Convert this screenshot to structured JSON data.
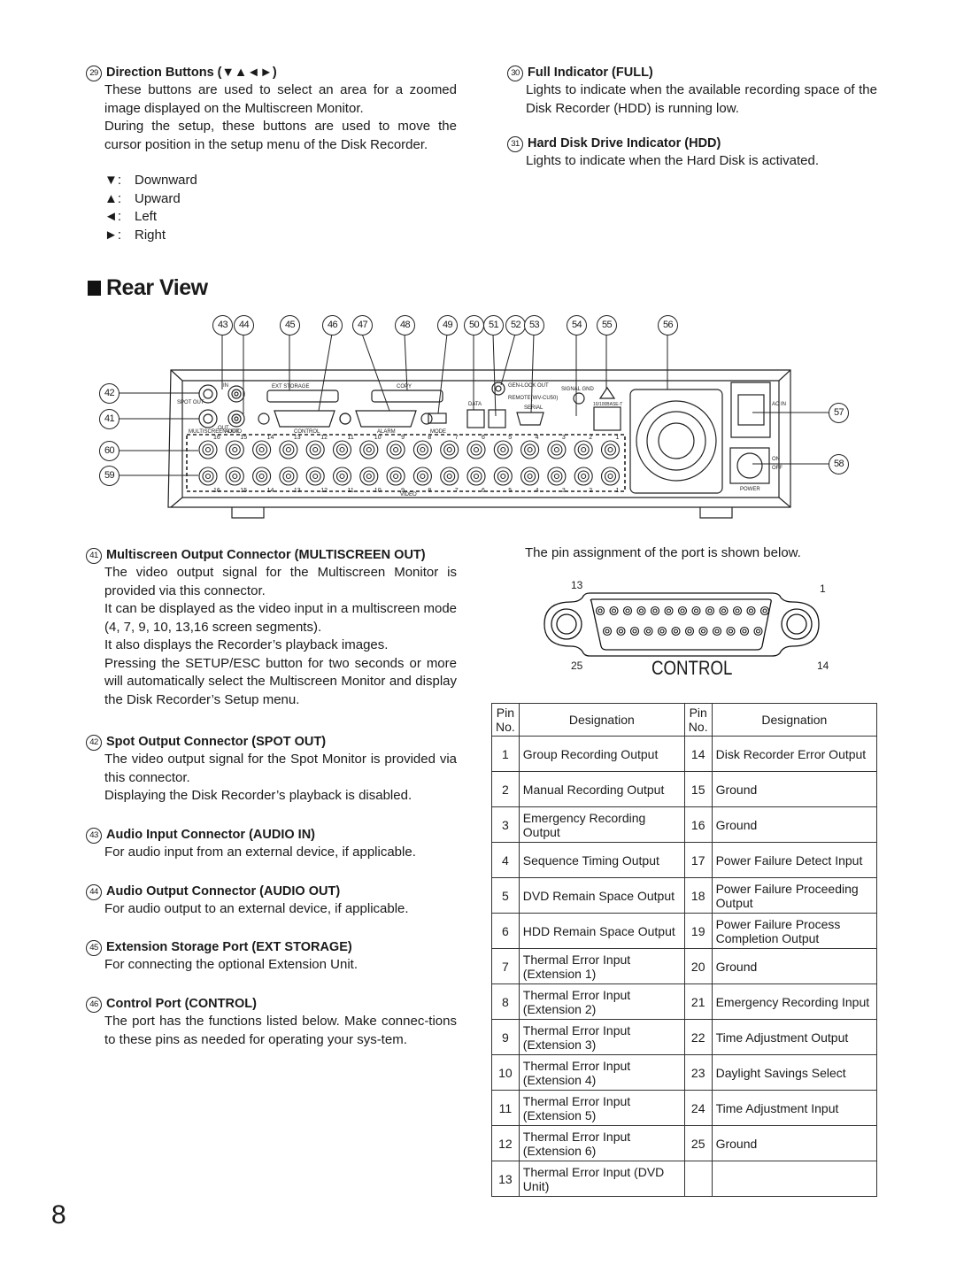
{
  "page_number": "8",
  "top_left": {
    "number": "29",
    "title": "Direction Buttons (▼▲◄►)",
    "paragraphs": [
      "These buttons are used to select an area for a zoomed image displayed on the Multiscreen Monitor.",
      "During the setup, these buttons are used to move the cursor position in the setup menu of the Disk Recorder."
    ],
    "directions": [
      {
        "symbol": "▼:",
        "label": "Downward"
      },
      {
        "symbol": "▲:",
        "label": "Upward"
      },
      {
        "symbol": "◄:",
        "label": "Left"
      },
      {
        "symbol": "►:",
        "label": "Right"
      }
    ]
  },
  "top_right": [
    {
      "number": "30",
      "title": "Full Indicator (FULL)",
      "text": "Lights to indicate when the available recording space of the Disk Recorder (HDD) is running low."
    },
    {
      "number": "31",
      "title": "Hard Disk Drive Indicator (HDD)",
      "text": "Lights to indicate when the Hard Disk is activated."
    }
  ],
  "rear_view": {
    "heading": "Rear View",
    "top_callouts": [
      "43",
      "44",
      "45",
      "46",
      "47",
      "48",
      "49",
      "50",
      "51",
      "52",
      "53",
      "54",
      "55",
      "56"
    ],
    "left_callouts": [
      "42",
      "41",
      "60",
      "59"
    ],
    "right_callouts": [
      "57",
      "58"
    ],
    "panel_labels": {
      "spot_out": "SPOT OUT",
      "in": "IN",
      "out": "OUT",
      "multiscreen_out": "MULTISCREEN OUT",
      "audio": "AUDIO",
      "ext_storage": "EXT STORAGE",
      "copy": "COPY",
      "control": "CONTROL",
      "alarm": "ALARM",
      "mode": "MODE",
      "data": "DATA",
      "genlock_out": "GEN-LOCK OUT",
      "remote": "REMOTE(WV-CU50)",
      "serial": "SERIAL",
      "signal_gnd": "SIGNAL GND",
      "ethernet": "10/100BASE-T",
      "ac_in": "AC IN",
      "on": "ON",
      "off": "OFF",
      "power": "POWER",
      "video": "VIDEO",
      "channels": [
        "16",
        "15",
        "14",
        "13",
        "12",
        "11",
        "10",
        "9",
        "8",
        "7",
        "6",
        "5",
        "4",
        "3",
        "2",
        "1"
      ]
    }
  },
  "left_sections": [
    {
      "number": "41",
      "title": "Multiscreen Output Connector (MULTISCREEN OUT)",
      "paragraphs": [
        "The video output signal for the Multiscreen Monitor is provided via this connector.",
        "It can be displayed as the video input in a multiscreen mode (4, 7, 9, 10, 13,16 screen segments).",
        "It also displays the Recorder’s playback images.",
        "Pressing the SETUP/ESC button for two seconds or more will automatically select the Multiscreen Monitor and display the Disk Recorder’s Setup menu."
      ]
    },
    {
      "number": "42",
      "title": "Spot Output Connector (SPOT OUT)",
      "paragraphs": [
        "The video output signal for the Spot Monitor is provided via this connector.",
        "Displaying the Disk Recorder’s playback is disabled."
      ]
    },
    {
      "number": "43",
      "title": "Audio Input Connector (AUDIO IN)",
      "paragraphs": [
        "For audio input from an external device, if applicable."
      ]
    },
    {
      "number": "44",
      "title": "Audio Output Connector (AUDIO OUT)",
      "paragraphs": [
        "For audio output to an external device, if applicable."
      ]
    },
    {
      "number": "45",
      "title": "Extension Storage Port (EXT STORAGE)",
      "paragraphs": [
        "For connecting the optional Extension Unit."
      ]
    },
    {
      "number": "46",
      "title": "Control Port (CONTROL)",
      "paragraphs": [
        "The port has the functions listed below. Make connec-tions to these pins as needed for operating your sys-tem."
      ]
    }
  ],
  "pin_section": {
    "intro": "The pin assignment of the port is shown below.",
    "connector": {
      "label": "CONTROL",
      "pin_top_left": "13",
      "pin_top_right": "1",
      "pin_bottom_left": "25",
      "pin_bottom_right": "14"
    },
    "table": {
      "headers": [
        "Pin No.",
        "Designation",
        "Pin No.",
        "Designation"
      ],
      "rows": [
        {
          "pin_a": "1",
          "des_a": "Group Recording Output",
          "pin_b": "14",
          "des_b": "Disk Recorder Error Output"
        },
        {
          "pin_a": "2",
          "des_a": "Manual Recording Output",
          "pin_b": "15",
          "des_b": "Ground"
        },
        {
          "pin_a": "3",
          "des_a": "Emergency Recording Output",
          "pin_b": "16",
          "des_b": "Ground"
        },
        {
          "pin_a": "4",
          "des_a": "Sequence Timing Output",
          "pin_b": "17",
          "des_b": "Power Failure Detect Input"
        },
        {
          "pin_a": "5",
          "des_a": "DVD Remain Space Output",
          "pin_b": "18",
          "des_b": "Power Failure Proceeding Output"
        },
        {
          "pin_a": "6",
          "des_a": "HDD Remain Space Output",
          "pin_b": "19",
          "des_b": "Power Failure Process Completion Output"
        },
        {
          "pin_a": "7",
          "des_a": "Thermal Error Input (Extension 1)",
          "pin_b": "20",
          "des_b": "Ground"
        },
        {
          "pin_a": "8",
          "des_a": "Thermal Error Input (Extension 2)",
          "pin_b": "21",
          "des_b": "Emergency Recording Input"
        },
        {
          "pin_a": "9",
          "des_a": "Thermal Error Input (Extension 3)",
          "pin_b": "22",
          "des_b": "Time Adjustment Output"
        },
        {
          "pin_a": "10",
          "des_a": "Thermal Error Input (Extension 4)",
          "pin_b": "23",
          "des_b": "Daylight Savings Select"
        },
        {
          "pin_a": "11",
          "des_a": "Thermal Error Input (Extension 5)",
          "pin_b": "24",
          "des_b": "Time Adjustment Input"
        },
        {
          "pin_a": "12",
          "des_a": "Thermal Error Input (Extension 6)",
          "pin_b": "25",
          "des_b": "Ground"
        },
        {
          "pin_a": "13",
          "des_a": "Thermal Error Input (DVD Unit)",
          "pin_b": "",
          "des_b": ""
        }
      ]
    }
  }
}
